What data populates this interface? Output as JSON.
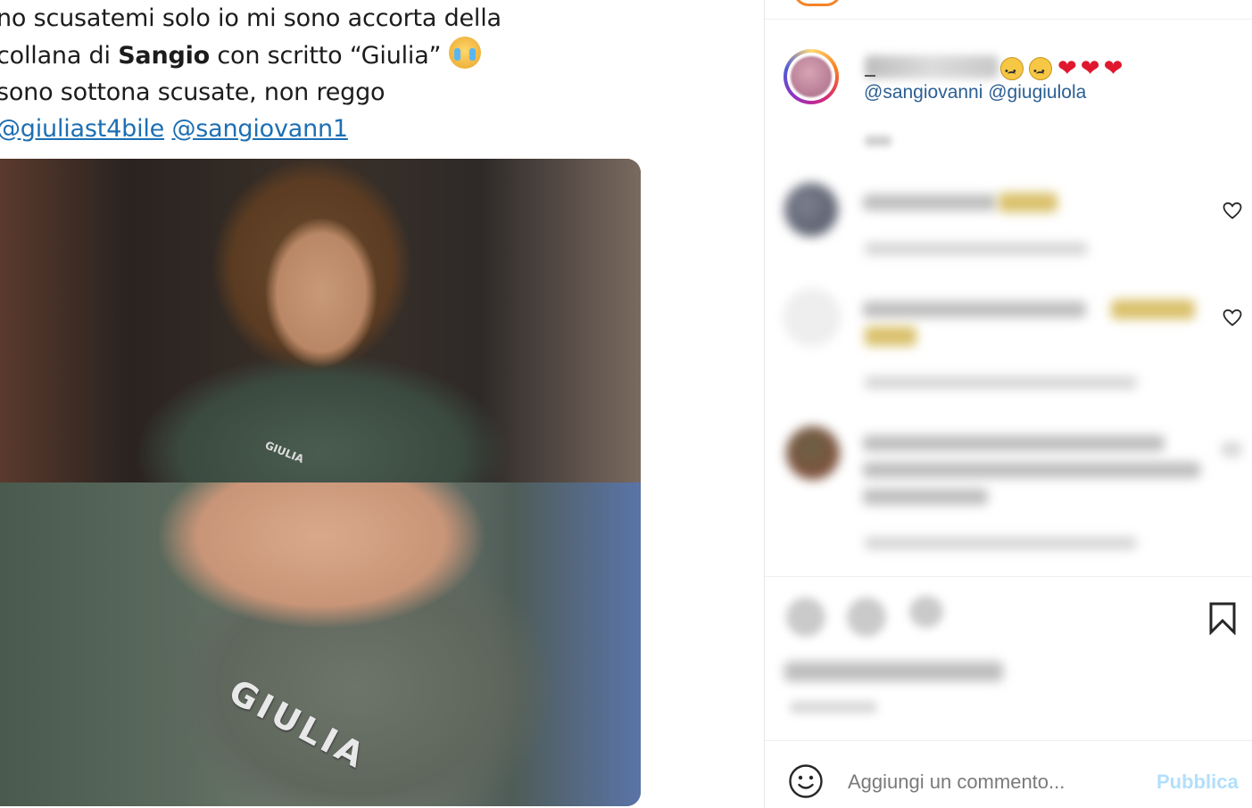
{
  "tweet": {
    "line1": "no scusatemi solo io mi sono accorta della",
    "line2_before": "collana di ",
    "line2_bold": "Sangio",
    "line2_after": " con scritto “Giulia” ",
    "line3": "sono sottona scusate, non reggo",
    "mention1": "@giuliast4bile",
    "mention2": "@sangiovann1",
    "emoji_icon": "crying-face-emoji-icon",
    "photo_necklace_text": "GIULIA"
  },
  "caption": {
    "mentions": "@sangiovanni @giugiulola",
    "emoji_icons": [
      "confused-face-icon",
      "confused-face-icon",
      "red-heart-icon",
      "red-heart-icon",
      "red-heart-icon"
    ],
    "heart": "❤"
  },
  "comment_box": {
    "placeholder": "Aggiungi un commento...",
    "publish_label": "Pubblica",
    "emoji_icon": "smiley-icon"
  },
  "colors": {
    "mention": "#2b5f92",
    "tweet_mention": "#1d6fb3",
    "publish_disabled": "#b2dffc",
    "heart": "#e0182d"
  }
}
